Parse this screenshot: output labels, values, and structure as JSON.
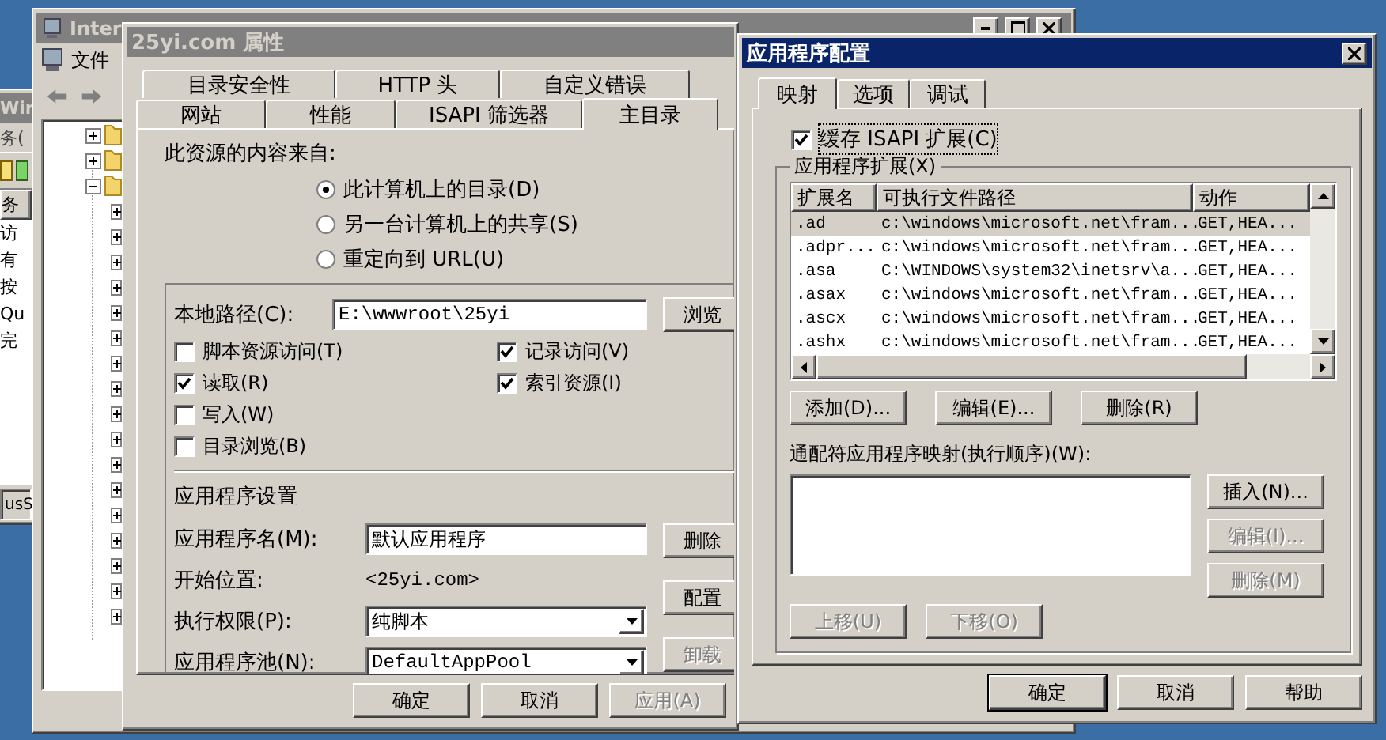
{
  "left_window": {
    "title": "Wir",
    "menu": "务(",
    "list_header": "务",
    "list_items": [
      "访",
      "有",
      "按",
      "Qu",
      "完"
    ],
    "status": "usS"
  },
  "iis_window": {
    "title": "Inter",
    "menu": "文件"
  },
  "properties_dialog": {
    "title": "25yi.com 属性",
    "tab_rows": [
      [
        {
          "label": "目录安全性",
          "selected": false
        },
        {
          "label": "HTTP 头",
          "selected": false
        },
        {
          "label": "自定义错误",
          "selected": false
        }
      ],
      [
        {
          "label": "网站",
          "selected": false
        },
        {
          "label": "性能",
          "selected": false
        },
        {
          "label": "ISAPI 筛选器",
          "selected": false
        },
        {
          "label": "主目录",
          "selected": true
        }
      ]
    ],
    "source_label": "此资源的内容来自:",
    "source_options": [
      {
        "label": "此计算机上的目录(D)",
        "selected": true
      },
      {
        "label": "另一台计算机上的共享(S)",
        "selected": false
      },
      {
        "label": "重定向到 URL(U)",
        "selected": false
      }
    ],
    "local_path": {
      "label": "本地路径(C):",
      "value": "E:\\wwwroot\\25yi",
      "button": "浏览"
    },
    "permissions_left": [
      {
        "label": "脚本资源访问(T)",
        "checked": false
      },
      {
        "label": "读取(R)",
        "checked": true
      },
      {
        "label": "写入(W)",
        "checked": false
      },
      {
        "label": "目录浏览(B)",
        "checked": false
      }
    ],
    "permissions_right": [
      {
        "label": "记录访问(V)",
        "checked": true
      },
      {
        "label": "索引资源(I)",
        "checked": true
      }
    ],
    "app_heading": "应用程序设置",
    "app_fields": [
      {
        "kind": "input",
        "label": "应用程序名(M):",
        "value": "默认应用程序"
      },
      {
        "kind": "text",
        "label": "开始位置:",
        "value": "<25yi.com>"
      },
      {
        "kind": "select",
        "label": "执行权限(P):",
        "value": "纯脚本"
      },
      {
        "kind": "select",
        "label": "应用程序池(N):",
        "value": "DefaultAppPool"
      }
    ],
    "app_buttons": [
      {
        "label": "删除",
        "disabled": false
      },
      {
        "label": "配置",
        "disabled": false
      },
      {
        "label": "卸载",
        "disabled": true
      }
    ],
    "buttons": [
      {
        "label": "确定",
        "disabled": false
      },
      {
        "label": "取消",
        "disabled": false
      },
      {
        "label": "应用(A)",
        "disabled": true
      }
    ]
  },
  "app_config": {
    "title": "应用程序配置",
    "tabs": [
      {
        "label": "映射",
        "selected": true
      },
      {
        "label": "选项",
        "selected": false
      },
      {
        "label": "调试",
        "selected": false
      }
    ],
    "cache": {
      "label": "缓存 ISAPI 扩展(C)",
      "checked": true
    },
    "extensions_group": "应用程序扩展(X)",
    "columns": [
      "扩展名",
      "可执行文件路径",
      "动作"
    ],
    "rows": [
      {
        "ext": ".ad",
        "path": "c:\\windows\\microsoft.net\\fram...",
        "verbs": "GET,HEA...",
        "selected": true
      },
      {
        "ext": ".adpr...",
        "path": "c:\\windows\\microsoft.net\\fram...",
        "verbs": "GET,HEA...",
        "selected": false
      },
      {
        "ext": ".asa",
        "path": "C:\\WINDOWS\\system32\\inetsrv\\a...",
        "verbs": "GET,HEA...",
        "selected": false
      },
      {
        "ext": ".asax",
        "path": "c:\\windows\\microsoft.net\\fram...",
        "verbs": "GET,HEA...",
        "selected": false
      },
      {
        "ext": ".ascx",
        "path": "c:\\windows\\microsoft.net\\fram...",
        "verbs": "GET,HEA...",
        "selected": false
      },
      {
        "ext": ".ashx",
        "path": "c:\\windows\\microsoft.net\\fram...",
        "verbs": "GET,HEA...",
        "selected": false
      }
    ],
    "ext_buttons": [
      {
        "label": "添加(D)...",
        "disabled": false
      },
      {
        "label": "编辑(E)...",
        "disabled": false
      },
      {
        "label": "删除(R)",
        "disabled": false
      }
    ],
    "wildcard_label": "通配符应用程序映射(执行顺序)(W):",
    "wildcard_buttons": [
      {
        "label": "插入(N)...",
        "disabled": false
      },
      {
        "label": "编辑(I)...",
        "disabled": true
      },
      {
        "label": "删除(M)",
        "disabled": true
      }
    ],
    "move_buttons": [
      {
        "label": "上移(U)",
        "disabled": true
      },
      {
        "label": "下移(O)",
        "disabled": true
      }
    ],
    "buttons": [
      {
        "label": "确定",
        "disabled": false,
        "default": true
      },
      {
        "label": "取消",
        "disabled": false,
        "default": false
      },
      {
        "label": "帮助",
        "disabled": false,
        "default": false
      }
    ]
  }
}
